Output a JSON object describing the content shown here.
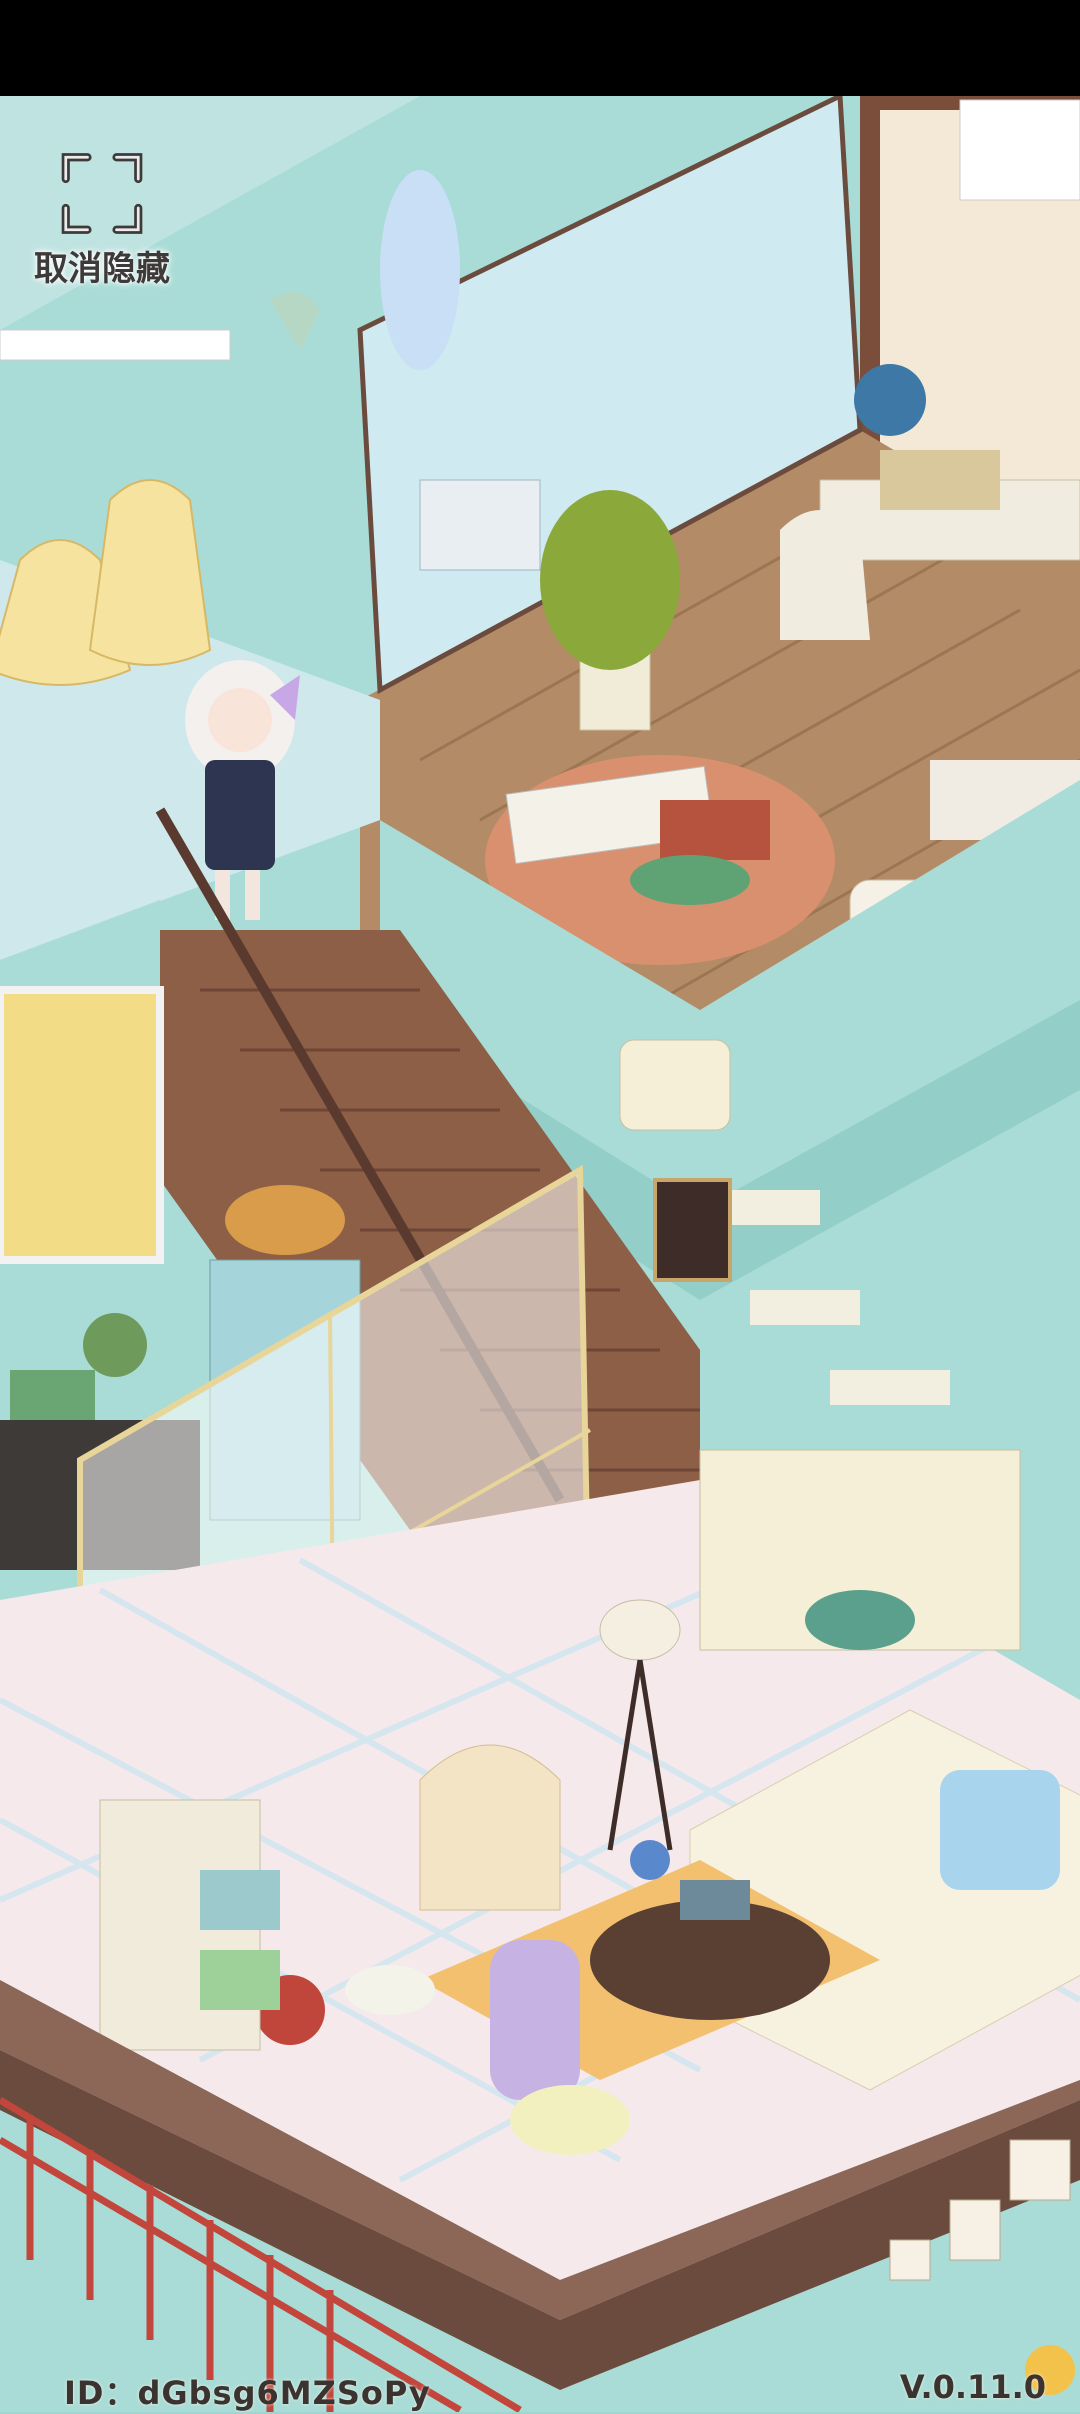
{
  "hud": {
    "unhide_label": "取消隐藏",
    "unhide_icon": "expand-frame-icon"
  },
  "footer": {
    "id_text": "ID：dGbsg6MZSoPy",
    "version_text": "V.0.11.0"
  },
  "colors": {
    "wall_teal": "#a9dcd6",
    "floor_wood": "#b38b66",
    "stair_brown": "#8e5f47",
    "rug_pink": "#f0b8a0",
    "tile_blue": "#cfe6f0",
    "tile_pink": "#f6d5d9",
    "outer_frame": "#6b4b3e",
    "railing_red": "#c2463b"
  }
}
